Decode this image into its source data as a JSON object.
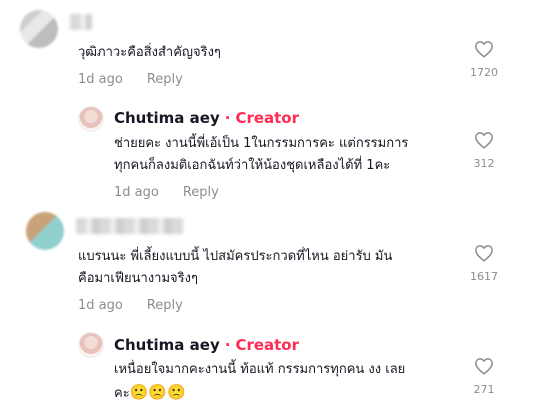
{
  "comments": [
    {
      "text": "วุฒิภาวะคือสิ่งสำคัญจริงๆ",
      "time": "1d ago",
      "reply": "Reply",
      "likes": "1720"
    },
    {
      "author": "Chutima aey",
      "separator": "·",
      "badge": "Creator",
      "text_line1": "ช่ายยคะ งานนี้พี่เอ้เป็น 1ในกรรมการคะ แต่กรรมการ",
      "text_line2": "ทุกคนก็ลงมติเอกฉันท์ว่าให้น้องชุดเหลืองได้ที่ 1คะ",
      "time": "1d ago",
      "reply": "Reply",
      "likes": "312"
    },
    {
      "text_line1": "แบรนนะ พี่เลี้ยงแบบนี้ ไปสมัครประกวดที่ไหน อย่ารับ มัน",
      "text_line2": "คือมาเฟียนางามจริงๆ",
      "time": "1d ago",
      "reply": "Reply",
      "likes": "1617"
    },
    {
      "author": "Chutima aey",
      "separator": "·",
      "badge": "Creator",
      "text_line1": "เหนื่อยใจมากคะงานนี้ ท้อแท้ กรรมการทุกคน งง เลย",
      "text_line2": "คะ",
      "emojis": "🙁🙁🙁",
      "likes": "271"
    }
  ],
  "icons": {
    "like": "heart-outline-icon"
  },
  "colors": {
    "accent": "#fe2c55",
    "text": "#161823",
    "muted": "rgba(22,24,35,0.5)"
  }
}
